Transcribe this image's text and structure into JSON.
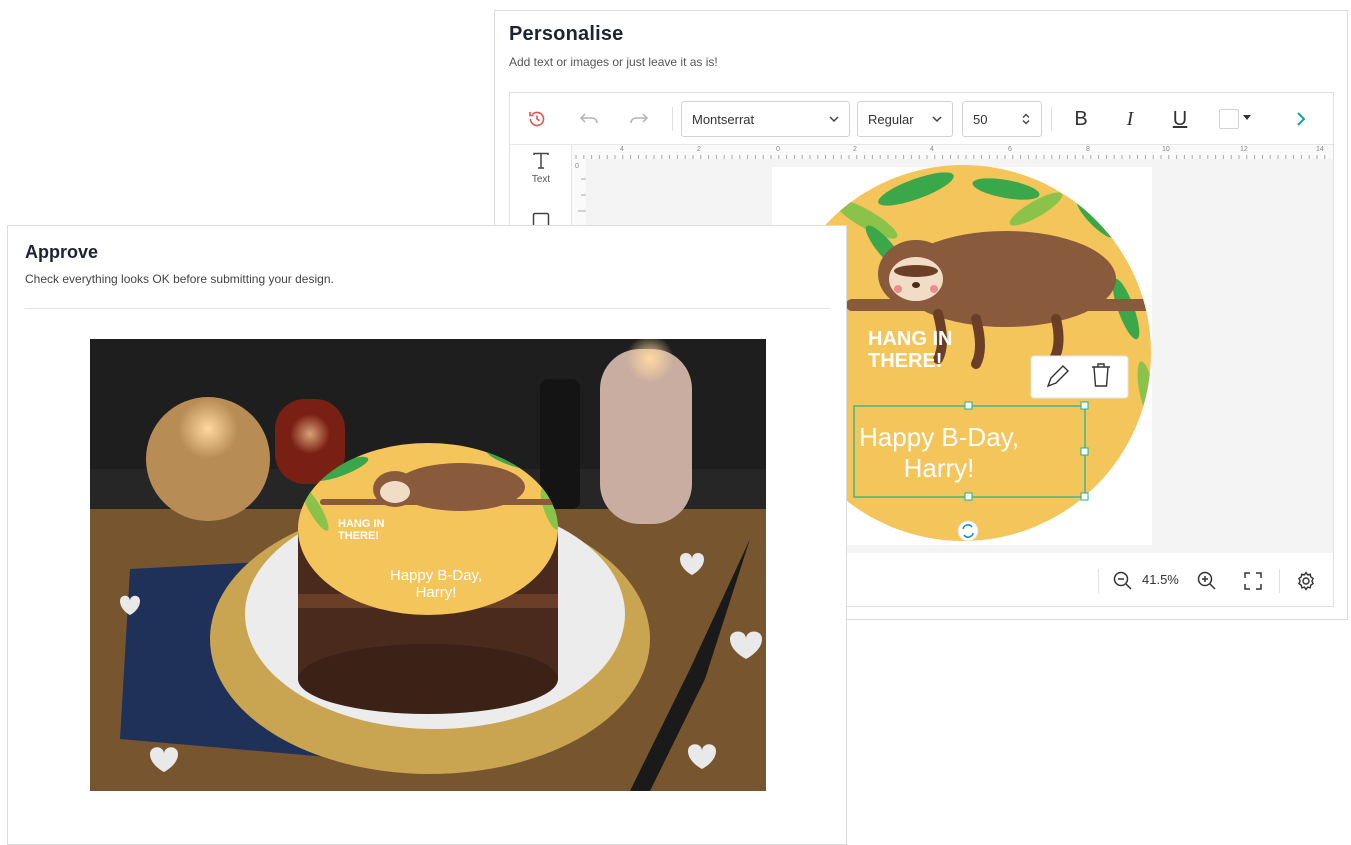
{
  "personalise": {
    "title": "Personalise",
    "subtitle": "Add text or images or just leave it as is!",
    "toolbar": {
      "font_family": "Montserrat",
      "font_weight": "Regular",
      "font_size": "50",
      "bold_label": "B",
      "italic_label": "I",
      "underline_label": "U"
    },
    "rail": {
      "text_label": "Text"
    },
    "ruler_top": [
      "4",
      "2",
      "0",
      "2",
      "4",
      "6",
      "8",
      "10",
      "12",
      "14"
    ],
    "ruler_left": [
      "0"
    ],
    "design": {
      "headline": [
        "HANG IN",
        "THERE!"
      ],
      "text_box_lines": [
        "Happy B-Day,",
        "Harry!"
      ]
    },
    "zoom": "41.5%"
  },
  "approve": {
    "title": "Approve",
    "subtitle": "Check everything looks OK before submitting your design.",
    "cake_topper": {
      "headline": [
        "HANG IN",
        "THERE!"
      ],
      "message_lines": [
        "Happy B-Day,",
        "Harry!"
      ]
    }
  },
  "colors": {
    "accent": "#1ab394",
    "topper_yellow": "#f4c55a",
    "leaf_green": "#3aa84a",
    "sloth_brown": "#8a5a3c",
    "history_red": "#e05555",
    "chevron_teal": "#16a39a"
  }
}
